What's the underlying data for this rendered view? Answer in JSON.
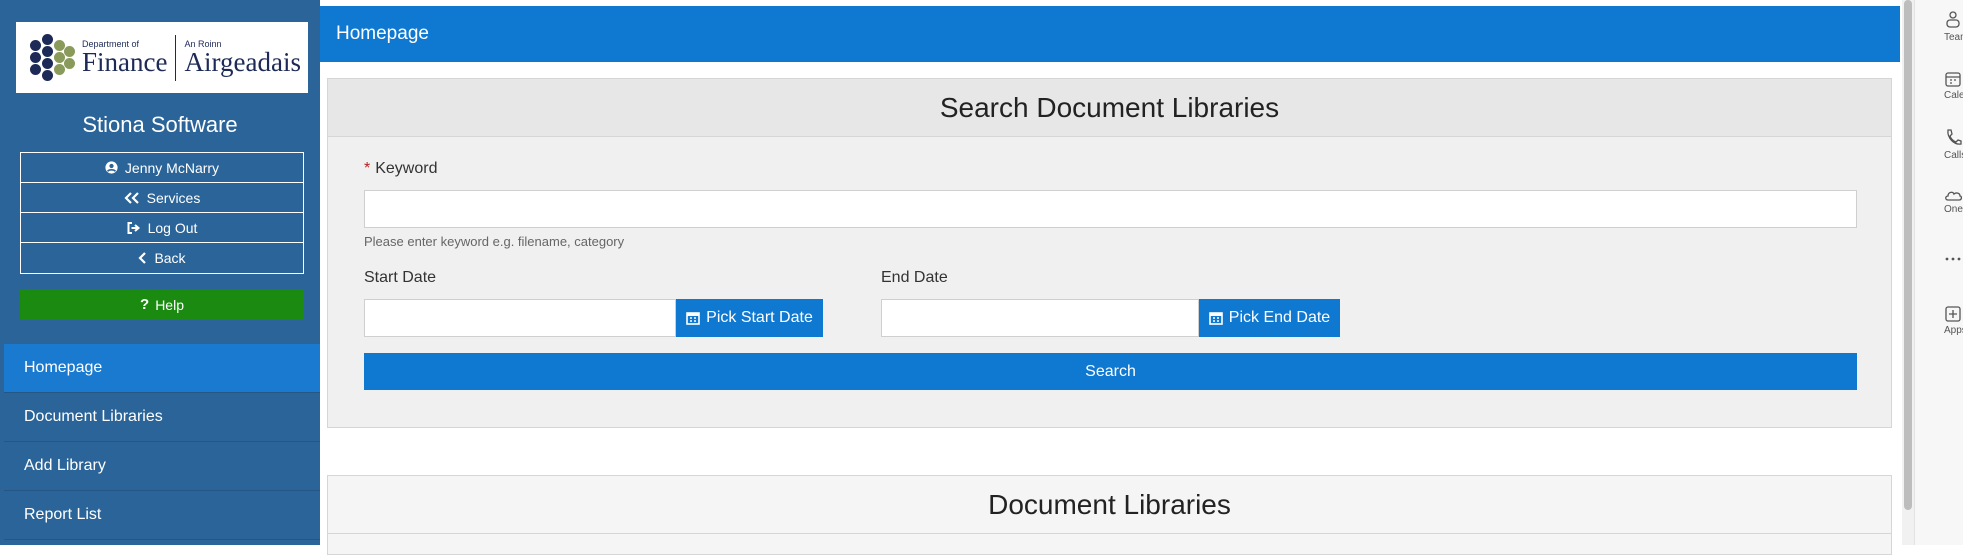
{
  "logo": {
    "left_small": "Department of",
    "left_big": "Finance",
    "right_small": "An Roinn",
    "right_big": "Airgeadais"
  },
  "app_title": "Stiona Software",
  "user_menu": [
    {
      "icon": "user-circle-icon",
      "label": "Jenny McNarry"
    },
    {
      "icon": "double-chevron-left-icon",
      "label": "Services"
    },
    {
      "icon": "sign-out-icon",
      "label": "Log Out"
    },
    {
      "icon": "chevron-left-icon",
      "label": "Back"
    }
  ],
  "help_label": "Help",
  "nav": [
    {
      "label": "Homepage",
      "active": true
    },
    {
      "label": "Document Libraries",
      "active": false
    },
    {
      "label": "Add Library",
      "active": false
    },
    {
      "label": "Report List",
      "active": false
    }
  ],
  "header_title": "Homepage",
  "search_panel": {
    "title": "Search Document Libraries",
    "keyword_required_mark": "*",
    "keyword_label": "Keyword",
    "keyword_value": "",
    "keyword_hint": "Please enter keyword e.g. filename, category",
    "start_date_label": "Start Date",
    "start_date_value": "",
    "pick_start_label": "Pick Start Date",
    "end_date_label": "End Date",
    "end_date_value": "",
    "pick_end_label": "Pick End Date",
    "search_label": "Search"
  },
  "libraries_panel": {
    "title": "Document Libraries"
  },
  "rail": [
    {
      "icon": "teams-icon",
      "label": "Teams"
    },
    {
      "icon": "calendar-icon",
      "label": "Calendar"
    },
    {
      "icon": "calls-icon",
      "label": "Calls"
    },
    {
      "icon": "onedrive-icon",
      "label": "OneDrive"
    },
    {
      "icon": "more-icon",
      "label": ""
    },
    {
      "icon": "apps-icon",
      "label": "Apps"
    }
  ],
  "colors": {
    "sidebar": "#2a6498",
    "accent_blue": "#0f78d0",
    "help_green": "#1a8a10",
    "active_nav": "#1a7ad0"
  }
}
